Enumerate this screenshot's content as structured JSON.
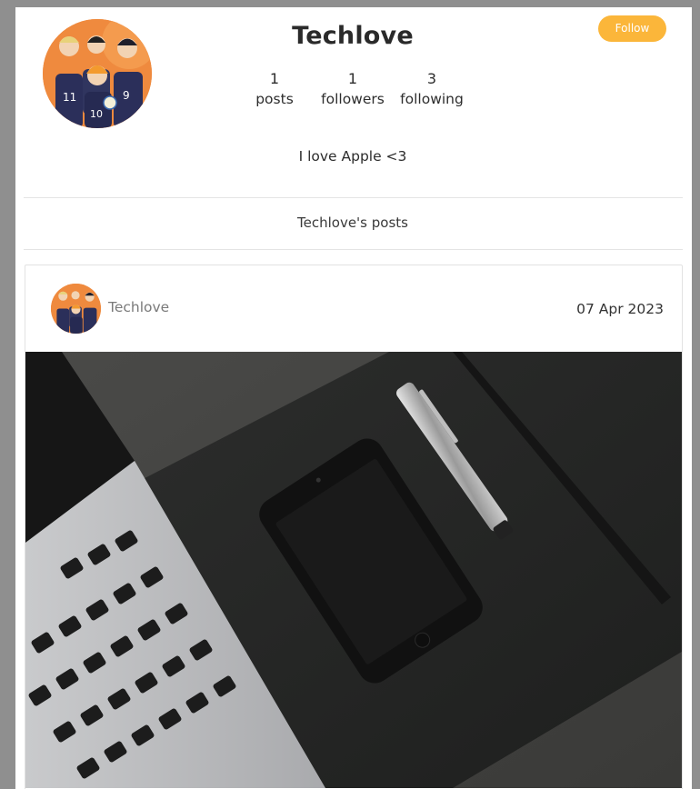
{
  "profile": {
    "name": "Techlove",
    "follow_label": "Follow",
    "stats": [
      {
        "value": "1",
        "label": "posts"
      },
      {
        "value": "1",
        "label": "followers"
      },
      {
        "value": "3",
        "label": "following"
      }
    ],
    "bio": "I love Apple <3"
  },
  "posts_section": {
    "heading": "Techlove's posts"
  },
  "post": {
    "author": "Techlove",
    "date": "07 Apr 2023"
  },
  "colors": {
    "accent": "#fbb63a",
    "background": "#8f8f8f"
  }
}
